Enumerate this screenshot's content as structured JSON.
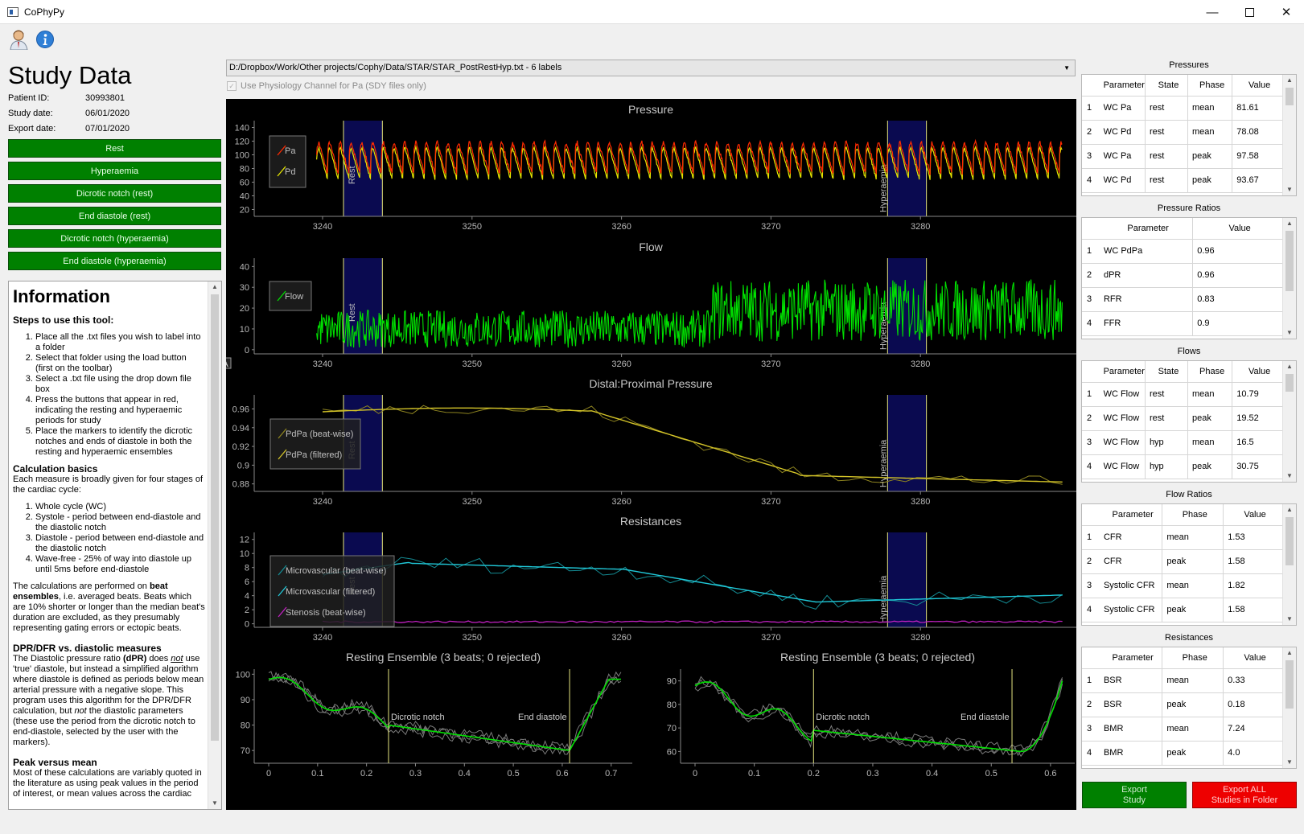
{
  "window": {
    "title": "CoPhyPy",
    "minimize_icon": "minimize-icon",
    "maximize_icon": "maximize-icon",
    "close_icon": "close-icon"
  },
  "toolbar": {
    "items": [
      {
        "icon": "user-load-icon"
      },
      {
        "icon": "info-icon"
      }
    ]
  },
  "study": {
    "title": "Study Data",
    "patient_label": "Patient ID:",
    "patient_id": "30993801",
    "study_date_label": "Study date:",
    "study_date": "06/01/2020",
    "export_date_label": "Export date:",
    "export_date": "07/01/2020",
    "buttons": [
      "Rest",
      "Hyperaemia",
      "Dicrotic notch (rest)",
      "End diastole (rest)",
      "Dicrotic notch (hyperaemia)",
      "End diastole (hyperaemia)"
    ],
    "button_color": "#008000"
  },
  "info": {
    "heading": "Information",
    "steps_title": "Steps to use this tool:",
    "steps": [
      "Place all the .txt files you wish to label into a folder",
      "Select that folder using the load button (first on the toolbar)",
      "Select a .txt file using the drop down file box",
      "Press the buttons that appear in red, indicating the resting and hyperaemic periods for study",
      "Place the markers to identify the dicrotic notches and ends of diastole in both the resting and hyperaemic ensembles"
    ],
    "calc_title": "Calculation basics",
    "calc_intro": "Each measure is broadly given for four stages of the cardiac cycle:",
    "stages": [
      "Whole cycle (WC)",
      "Systole - period between end-diastole and the diastolic notch",
      "Diastole - period between end-diastole and the diastolic notch",
      "Wave-free - 25% of way into diastole up until 5ms before end-diastole"
    ],
    "ensemble_p1": "The calculations are performed on ",
    "ensemble_b": "beat ensembles",
    "ensemble_p2": ", i.e. averaged beats. Beats which are 10% shorter or longer than the median beat's duration are excluded, as they presumably representing gating errors or ectopic beats.",
    "dpr_title": "DPR/DFR vs. diastolic measures",
    "dpr_p1": "The Diastolic pressure ratio ",
    "dpr_b": "(dPR)",
    "dpr_p2": " does ",
    "dpr_not": "not",
    "dpr_p3": " use 'true' diastole, but instead a simplified algorithm where diastole is defined as periods below mean arterial pressure with a negative slope. This program uses this algorithm for the DPR/DFR calculation, but ",
    "dpr_not2": "not",
    "dpr_p4": " the diastolic parameters (these use the period from the dicrotic notch to end-diastole, selected by the user with the markers).",
    "peak_title": "Peak versus mean",
    "peak_text": "Most of these calculations are variably quoted in the literature as using peak values in the period of interest, or mean values across the cardiac"
  },
  "file": {
    "path": "D:/Dropbox/Work/Other projects/Cophy/Data/STAR/STAR_PostRestHyp.txt - 6 labels",
    "physio_label": "Use Physiology Channel for Pa (SDY files only)"
  },
  "plots": {
    "rest_label": "Rest",
    "hyp_label": "Hyperaemia",
    "pressure": {
      "title": "Pressure",
      "legend": [
        "Pa",
        "Pd"
      ],
      "yticks": [
        "140",
        "120",
        "100",
        "80",
        "60",
        "40",
        "20"
      ],
      "xticks": [
        "3240",
        "3250",
        "3260",
        "3270",
        "3280"
      ]
    },
    "flow": {
      "title": "Flow",
      "legend": [
        "Flow"
      ],
      "yticks": [
        "40",
        "30",
        "20",
        "10",
        "0"
      ],
      "xticks": [
        "3240",
        "3250",
        "3260",
        "3270",
        "3280"
      ]
    },
    "pdpa": {
      "title": "Distal:Proximal Pressure",
      "legend": [
        "PdPa (beat-wise)",
        "PdPa (filtered)"
      ],
      "yticks": [
        "0.96",
        "0.94",
        "0.92",
        "0.9",
        "0.88"
      ],
      "xticks": [
        "3240",
        "3250",
        "3260",
        "3270",
        "3280"
      ]
    },
    "resist": {
      "title": "Resistances",
      "legend": [
        "Microvascular (beat-wise)",
        "Microvascular (filtered)",
        "Stenosis (beat-wise)"
      ],
      "yticks": [
        "12",
        "10",
        "8",
        "6",
        "4",
        "2",
        "0"
      ],
      "xticks": [
        "3240",
        "3250",
        "3260",
        "3270",
        "3280"
      ]
    },
    "ens_rest": {
      "title": "Resting Ensemble (3 beats; 0 rejected)",
      "yticks": [
        "100",
        "90",
        "80",
        "70"
      ],
      "xticks": [
        "0",
        "0.1",
        "0.2",
        "0.3",
        "0.4",
        "0.5",
        "0.6",
        "0.7"
      ],
      "notch": "Dicrotic notch",
      "enddia": "End diastole"
    },
    "ens_hyp": {
      "title": "Resting Ensemble (3 beats; 0 rejected)",
      "yticks": [
        "90",
        "80",
        "70",
        "60"
      ],
      "xticks": [
        "0",
        "0.1",
        "0.2",
        "0.3",
        "0.4",
        "0.5",
        "0.6"
      ],
      "notch": "Dicrotic notch",
      "enddia": "End diastole"
    },
    "colors": {
      "pa": "#ff2a00",
      "pd": "#e6e600",
      "flow": "#00e000",
      "pdpa": "#d4c428",
      "micro": "#20c8d8",
      "stenosis": "#c020c0",
      "rest_band": "#0a0a50",
      "marker": "#e6e680"
    }
  },
  "tables": {
    "pressures": {
      "title": "Pressures",
      "headers": [
        "Parameter",
        "State",
        "Phase",
        "Value"
      ],
      "rows": [
        [
          "1",
          "WC Pa",
          "rest",
          "mean",
          "81.61"
        ],
        [
          "2",
          "WC Pd",
          "rest",
          "mean",
          "78.08"
        ],
        [
          "3",
          "WC Pa",
          "rest",
          "peak",
          "97.58"
        ],
        [
          "4",
          "WC Pd",
          "rest",
          "peak",
          "93.67"
        ]
      ]
    },
    "pratios": {
      "title": "Pressure Ratios",
      "headers": [
        "Parameter",
        "Value"
      ],
      "rows": [
        [
          "1",
          "WC PdPa",
          "0.96"
        ],
        [
          "2",
          "dPR",
          "0.96"
        ],
        [
          "3",
          "RFR",
          "0.83"
        ],
        [
          "4",
          "FFR",
          "0.9"
        ]
      ]
    },
    "flows": {
      "title": "Flows",
      "headers": [
        "Parameter",
        "State",
        "Phase",
        "Value"
      ],
      "rows": [
        [
          "1",
          "WC Flow",
          "rest",
          "mean",
          "10.79"
        ],
        [
          "2",
          "WC Flow",
          "rest",
          "peak",
          "19.52"
        ],
        [
          "3",
          "WC Flow",
          "hyp",
          "mean",
          "16.5"
        ],
        [
          "4",
          "WC Flow",
          "hyp",
          "peak",
          "30.75"
        ]
      ]
    },
    "fratios": {
      "title": "Flow Ratios",
      "headers": [
        "Parameter",
        "Phase",
        "Value"
      ],
      "rows": [
        [
          "1",
          "CFR",
          "mean",
          "1.53"
        ],
        [
          "2",
          "CFR",
          "peak",
          "1.58"
        ],
        [
          "3",
          "Systolic CFR",
          "mean",
          "1.82"
        ],
        [
          "4",
          "Systolic CFR",
          "peak",
          "1.58"
        ]
      ]
    },
    "resist": {
      "title": "Resistances",
      "headers": [
        "Parameter",
        "Phase",
        "Value"
      ],
      "rows": [
        [
          "1",
          "BSR",
          "mean",
          "0.33"
        ],
        [
          "2",
          "BSR",
          "peak",
          "0.18"
        ],
        [
          "3",
          "BMR",
          "mean",
          "7.24"
        ],
        [
          "4",
          "BMR",
          "peak",
          "4.0"
        ]
      ]
    }
  },
  "export": {
    "study_label": "Export\nStudy",
    "all_label": "Export ALL\nStudies in Folder",
    "study_color": "#008000",
    "all_color": "#ee0000"
  }
}
